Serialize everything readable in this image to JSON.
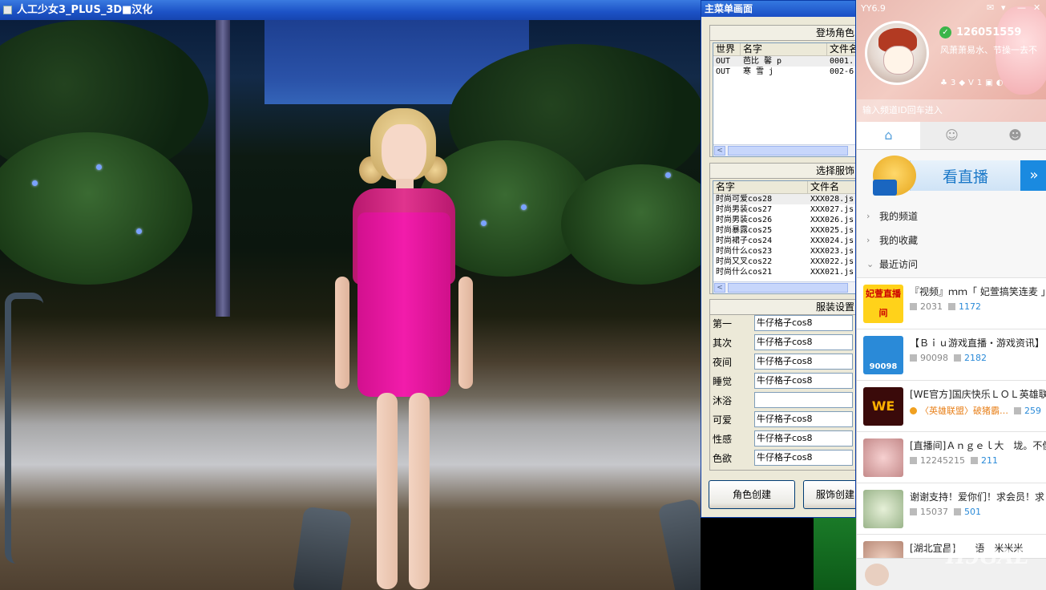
{
  "game": {
    "title": "人工少女3_PLUS_3D■汉化"
  },
  "menu": {
    "title": "主菜单画面",
    "characters": {
      "group_title": "登场角色",
      "columns": [
        "世界",
        "名字",
        "文件名"
      ],
      "rows": [
        {
          "world": "OUT",
          "name": "芭比 馨 p",
          "file": "0001."
        },
        {
          "world": "OUT",
          "name": "寒 雪 j",
          "file": "002-6"
        }
      ]
    },
    "outfits": {
      "group_title": "选择服饰",
      "columns": [
        "名字",
        "文件名"
      ],
      "rows": [
        {
          "name": "时尚可爱cos28",
          "file": "XXX028.js"
        },
        {
          "name": "时尚男装cos27",
          "file": "XXX027.js"
        },
        {
          "name": "时尚男装cos26",
          "file": "XXX026.js"
        },
        {
          "name": "时尚暴露cos25",
          "file": "XXX025.js"
        },
        {
          "name": "时尚裙子cos24",
          "file": "XXX024.js"
        },
        {
          "name": "时尚什么cos23",
          "file": "XXX023.js"
        },
        {
          "name": "时尚又叉cos22",
          "file": "XXX022.js"
        },
        {
          "name": "时尚什么cos21",
          "file": "XXX021.js"
        }
      ]
    },
    "settings": {
      "group_title": "服装设置",
      "rows": [
        {
          "label": "第一",
          "value": "牛仔格子cos8"
        },
        {
          "label": "其次",
          "value": "牛仔格子cos8"
        },
        {
          "label": "夜间",
          "value": "牛仔格子cos8"
        },
        {
          "label": "睡觉",
          "value": "牛仔格子cos8"
        },
        {
          "label": "沐浴",
          "value": ""
        },
        {
          "label": "可爱",
          "value": "牛仔格子cos8"
        },
        {
          "label": "性感",
          "value": "牛仔格子cos8"
        },
        {
          "label": "色欲",
          "value": "牛仔格子cos8"
        }
      ]
    },
    "buttons": {
      "create_character": "角色创建",
      "create_outfit": "服饰创建"
    }
  },
  "yy": {
    "version": "YY6.9",
    "uid": "126051559",
    "signature": "风萧萧易水、节操一去不",
    "badges": {
      "count1": "3",
      "count2": "1"
    },
    "search_placeholder": "输入频道ID回车进入",
    "live_label": "看直播",
    "live_arrow": "»",
    "nav": [
      "我的频道",
      "我的收藏",
      "最近访问"
    ],
    "channels": [
      {
        "title": "『视频』ｍｍ「 妃萱搞笑连麦 」",
        "n1": "2031",
        "n2": "1172",
        "thumb_text": "妃萱直播间"
      },
      {
        "title": "【Ｂｉｕ游戏直播・游戏资讯】",
        "n1": "90098",
        "n2": "2182",
        "thumb_text": "90098"
      },
      {
        "title": "[WE官方]国庆快乐ＬＯＬ英雄联盟",
        "n1": "〈英雄联盟〉破猪霸…",
        "n2": "259",
        "thumb_text": "WE"
      },
      {
        "title": "[直播间]Ａｎｇｅｌ大　垅。不傻",
        "n1": "12245215",
        "n2": "211",
        "thumb_text": ""
      },
      {
        "title": "谢谢支持！爱你们！求会员！求",
        "n1": "15037",
        "n2": "501",
        "thumb_text": ""
      },
      {
        "title": "[湖北宜昌]　　语　米米米",
        "n1": "",
        "n2": "",
        "thumb_text": ""
      }
    ]
  },
  "watermark": "H5GAL",
  "colors": {
    "xp_title": "#1a4ec4",
    "dress": "#f21cab",
    "yy_accent": "#1a8ae0"
  }
}
